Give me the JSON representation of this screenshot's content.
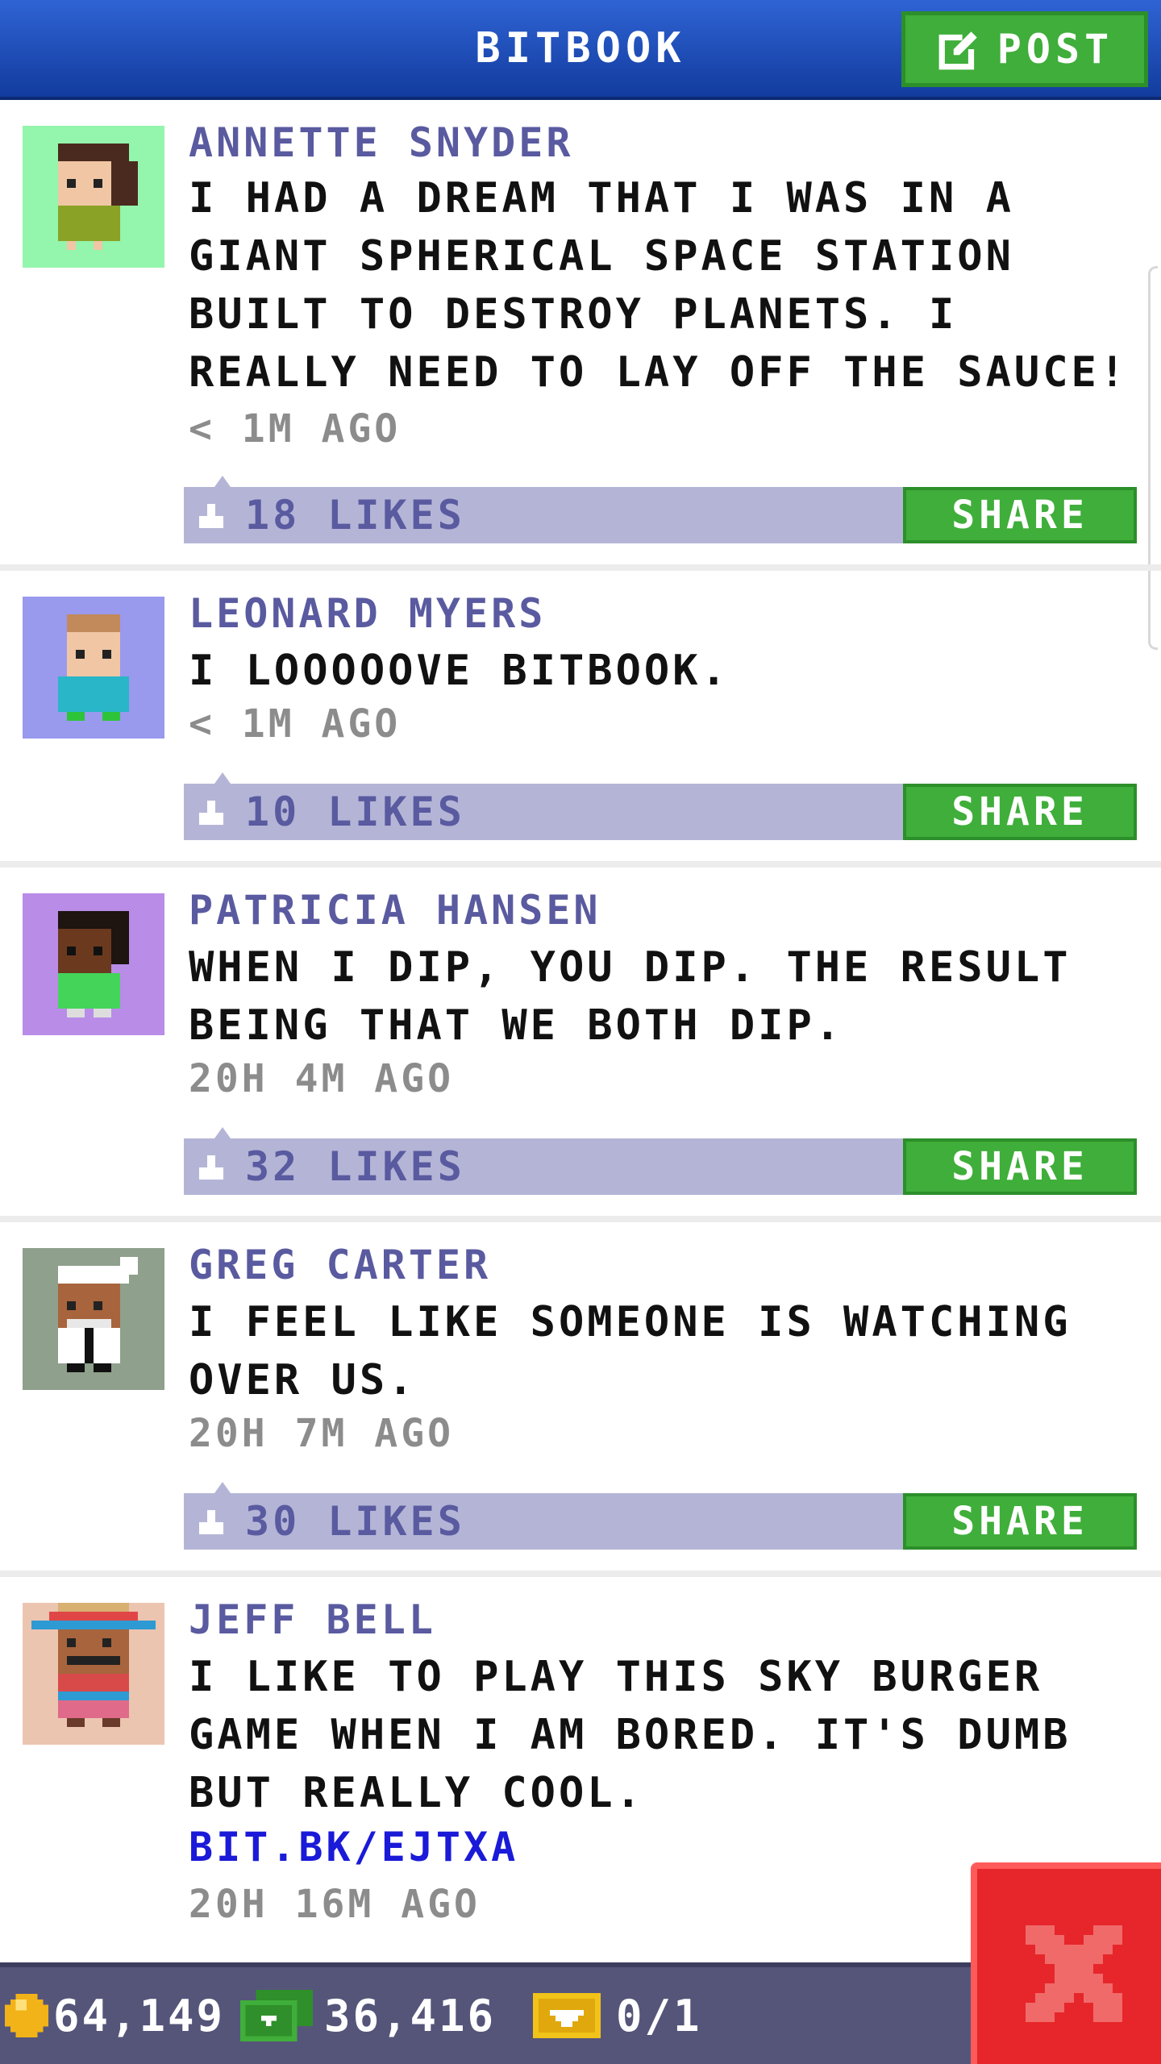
{
  "header": {
    "title": "BITBOOK",
    "post_label": "POST"
  },
  "posts": [
    {
      "author": "ANNETTE SNYDER",
      "text": "I HAD A DREAM THAT I WAS IN A GIANT SPHERICAL SPACE STATION BUILT TO DESTROY PLANETS. I REALLY NEED TO LAY OFF THE SAUCE!",
      "time": "< 1M AGO",
      "likes": "18 LIKES",
      "share_label": "SHARE",
      "avatar_bg": "#94f5ac"
    },
    {
      "author": "LEONARD MYERS",
      "text": "I LOOOOOVE BITBOOK.",
      "time": "< 1M AGO",
      "likes": "10 LIKES",
      "share_label": "SHARE",
      "avatar_bg": "#9999ee"
    },
    {
      "author": "PATRICIA HANSEN",
      "text": "WHEN I DIP, YOU DIP. THE RESULT BEING THAT WE BOTH DIP.",
      "time": "20H 4M AGO",
      "likes": "32 LIKES",
      "share_label": "SHARE",
      "avatar_bg": "#b98ce8"
    },
    {
      "author": "GREG CARTER",
      "text": "I FEEL LIKE SOMEONE IS WATCHING OVER US.",
      "time": "20H 7M AGO",
      "likes": "30 LIKES",
      "share_label": "SHARE",
      "avatar_bg": "#8fa08c"
    },
    {
      "author": "JEFF BELL",
      "text": "I LIKE TO PLAY THIS SKY BURGER GAME WHEN I AM BORED. IT'S DUMB BUT REALLY COOL.",
      "link": "BIT.BK/EJTXA",
      "time": "20H 16M AGO",
      "avatar_bg": "#ecc5b0"
    }
  ],
  "footer": {
    "coins": "64,149",
    "bux": "36,416",
    "tickets": "0/1"
  },
  "colors": {
    "header_blue": "#2453c0",
    "button_green": "#3fae3a",
    "like_bar": "#b4b5d6",
    "author_purple": "#5a5aa0",
    "close_red": "#e6262a"
  }
}
